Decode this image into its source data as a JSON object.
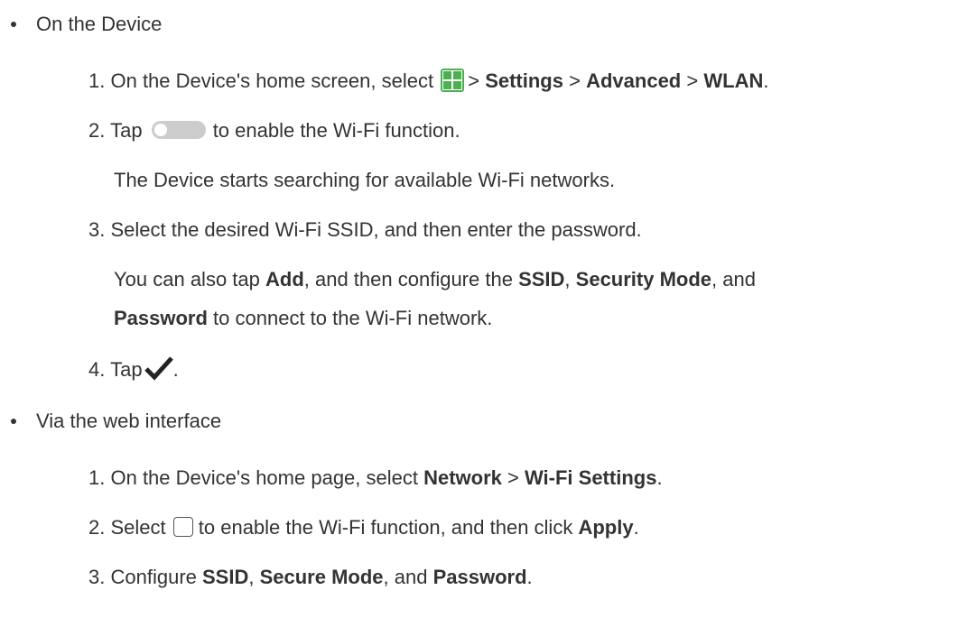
{
  "colors": {
    "text": "#333333",
    "apps_icon": "#4caf50",
    "toggle_off": "#cccccc",
    "check": "#222222"
  },
  "sections": [
    {
      "title": "On the Device",
      "steps": [
        {
          "number": "1.",
          "pre": "On the Device's home screen, select",
          "icon": "apps-grid-icon",
          "path": [
            ">",
            "Settings",
            ">",
            "Advanced",
            ">",
            "WLAN",
            "."
          ]
        },
        {
          "number": "2.",
          "pre": "Tap",
          "icon": "toggle-switch-icon",
          "post": "to enable the Wi-Fi function.",
          "note": "The Device starts searching for available Wi-Fi networks."
        },
        {
          "number": "3.",
          "text": "Select the desired Wi-Fi SSID, and then enter the password.",
          "note_line1": [
            "You can also tap ",
            "Add",
            ", and then configure the ",
            "SSID",
            ", ",
            "Security Mode",
            ", and"
          ],
          "note_line2": [
            "Password",
            " to connect to the Wi-Fi network."
          ]
        },
        {
          "number": "4.",
          "pre": "Tap",
          "icon": "checkmark-icon",
          "post": "."
        }
      ]
    },
    {
      "title": "Via the web interface",
      "steps": [
        {
          "number": "1.",
          "pre": "On the Device's home page, select ",
          "path": [
            "Network",
            " > ",
            "Wi-Fi Settings",
            "."
          ]
        },
        {
          "number": "2.",
          "pre": "Select",
          "icon": "checkbox-icon",
          "post": "to enable the Wi-Fi function, and then click ",
          "bold": "Apply",
          "end": "."
        },
        {
          "number": "3.",
          "parts": [
            "Configure ",
            "SSID",
            ", ",
            "Secure Mode",
            ", and ",
            "Password",
            "."
          ]
        }
      ]
    }
  ]
}
